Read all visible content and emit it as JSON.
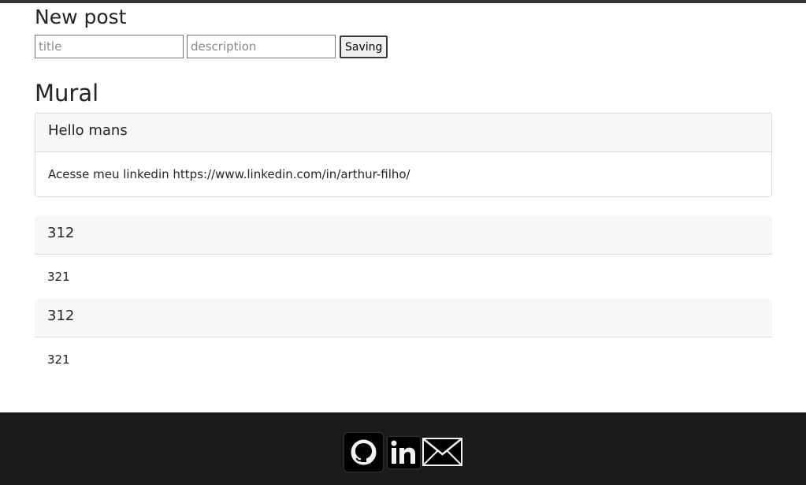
{
  "form": {
    "heading": "New post",
    "title_placeholder": "title",
    "description_placeholder": "description",
    "submit_label": "Saving"
  },
  "mural": {
    "heading": "Mural",
    "posts": [
      {
        "title": "Hello mans",
        "description": "Acesse meu linkedin https://www.linkedin.com/in/arthur-filho/"
      },
      {
        "title": "312",
        "description": "321"
      },
      {
        "title": "312",
        "description": "321"
      }
    ]
  },
  "footer": {
    "icons": [
      "github-icon",
      "linkedin-icon",
      "mail-icon"
    ]
  }
}
